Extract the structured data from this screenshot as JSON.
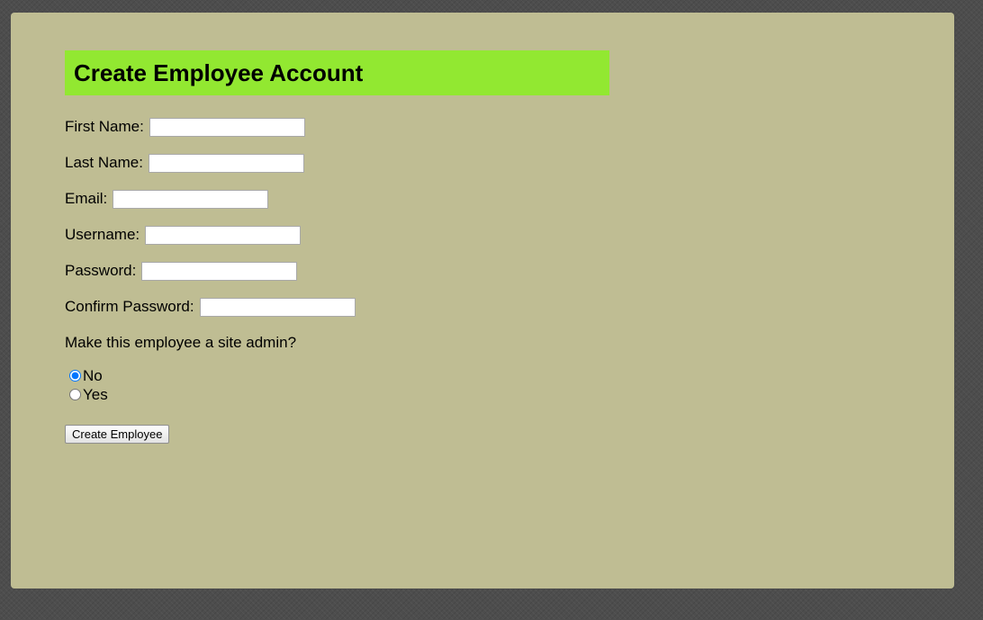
{
  "form": {
    "title": "Create Employee Account",
    "fields": {
      "first_name": {
        "label": "First Name:",
        "value": "",
        "placeholder": ""
      },
      "last_name": {
        "label": "Last Name:",
        "value": "",
        "placeholder": ""
      },
      "email": {
        "label": "Email:",
        "value": "",
        "placeholder": ""
      },
      "username": {
        "label": "Username:",
        "value": "",
        "placeholder": ""
      },
      "password": {
        "label": "Password:",
        "value": "",
        "placeholder": ""
      },
      "confirm_password": {
        "label": "Confirm Password:",
        "value": "",
        "placeholder": ""
      }
    },
    "admin_question": "Make this employee a site admin?",
    "admin_options": {
      "no": {
        "label": "No",
        "selected": true
      },
      "yes": {
        "label": "Yes",
        "selected": false
      }
    },
    "submit_label": "Create Employee"
  },
  "colors": {
    "page_background": "#4d4d4d",
    "panel_background": "#bfbd93",
    "header_background": "#92e831"
  }
}
